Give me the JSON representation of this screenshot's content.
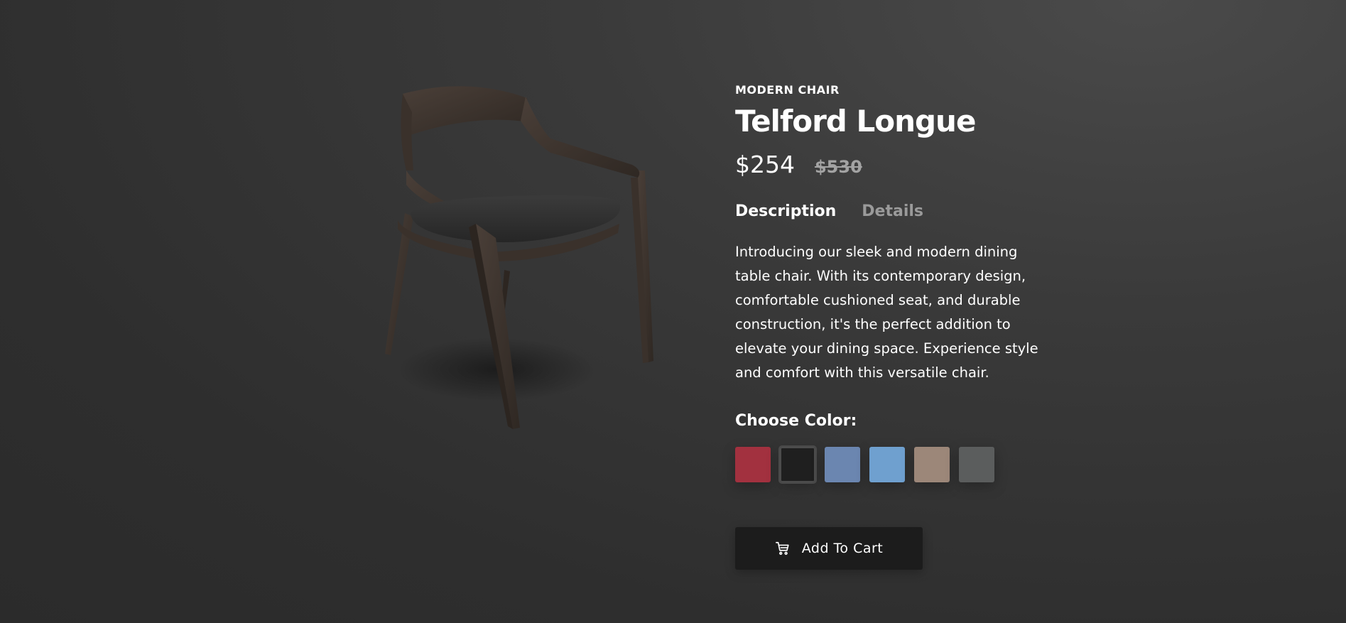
{
  "product": {
    "category": "MODERN CHAIR",
    "name": "Telford Longue",
    "price": "$254",
    "old_price": "$530"
  },
  "tabs": [
    {
      "label": "Description",
      "active": true
    },
    {
      "label": "Details",
      "active": false
    }
  ],
  "description": "Introducing our sleek and modern dining table chair. With its contemporary design, comfortable cushioned seat, and durable construction, it's the perfect addition to elevate your dining space. Experience style and comfort with this versatile chair.",
  "color_picker": {
    "label": "Choose Color:",
    "swatches": [
      {
        "color": "#a2313f",
        "selected": false
      },
      {
        "color": "#1f1f1f",
        "selected": true
      },
      {
        "color": "#6b86b0",
        "selected": false
      },
      {
        "color": "#6fa0cf",
        "selected": false
      },
      {
        "color": "#9c8779",
        "selected": false
      },
      {
        "color": "#5b5d5d",
        "selected": false
      }
    ]
  },
  "cart": {
    "label": "Add To Cart",
    "icon": "cart-icon"
  }
}
